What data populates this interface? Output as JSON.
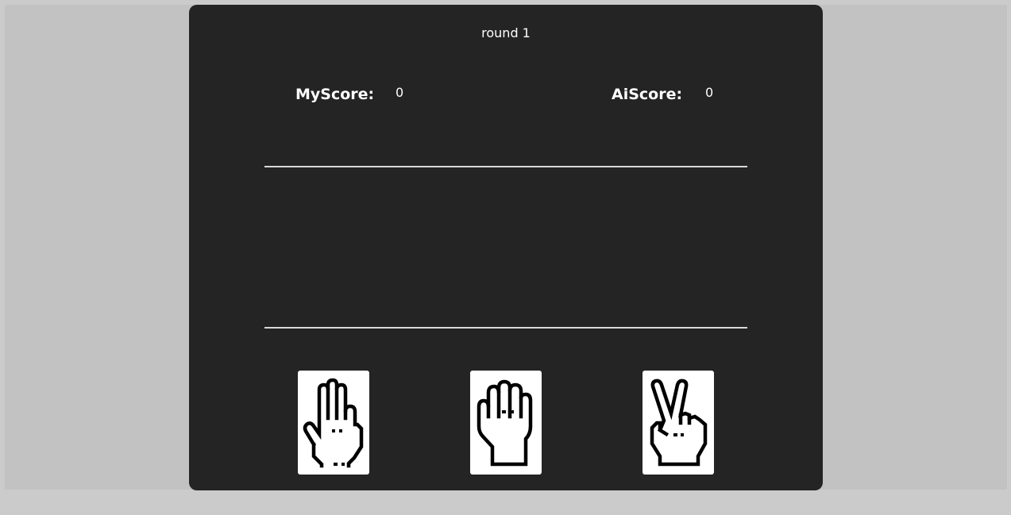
{
  "round_label": "round 1",
  "scores": {
    "my_label": "MyScore:",
    "my_value": "0",
    "ai_label": "AiScore:",
    "ai_value": "0"
  },
  "choices": [
    {
      "name": "paper",
      "icon": "open-hand-icon"
    },
    {
      "name": "rock",
      "icon": "fist-icon"
    },
    {
      "name": "scissors",
      "icon": "peace-sign-icon"
    }
  ],
  "colors": {
    "page_background": "#c2c2c2",
    "panel_background": "#242424",
    "text": "#ffffff",
    "divider": "#d9d9d9",
    "card_background": "#ffffff",
    "icon_stroke": "#000000"
  }
}
